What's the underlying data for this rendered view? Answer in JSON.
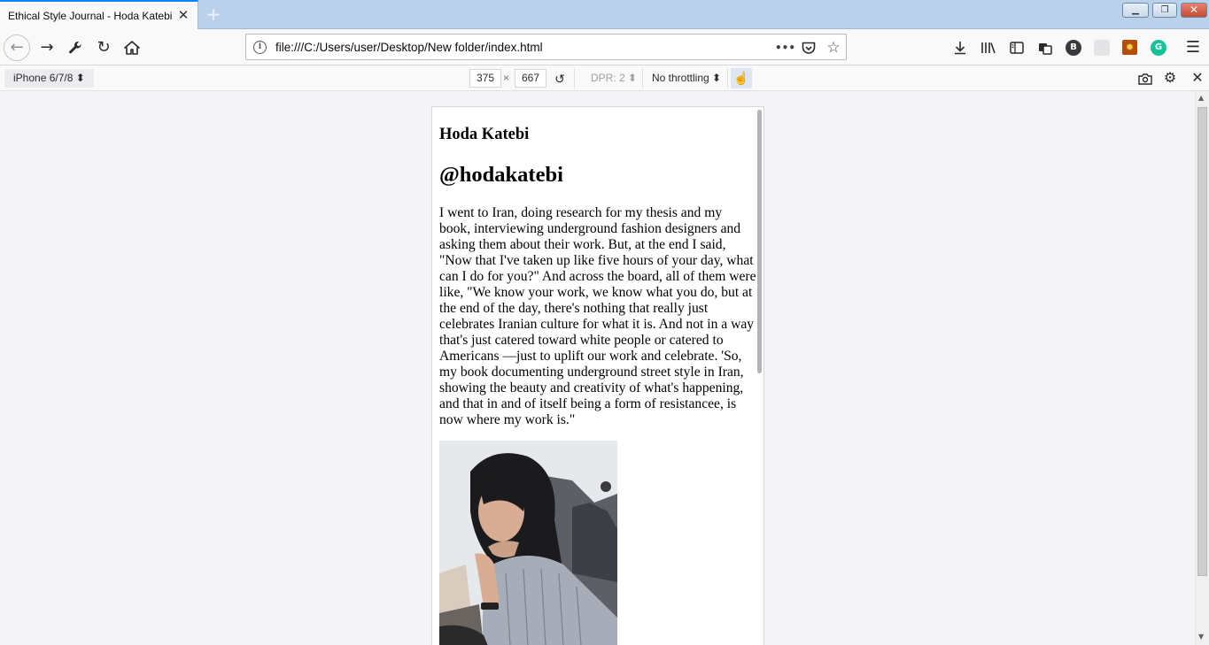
{
  "browser": {
    "tab_title": "Ethical Style Journal - Hoda Katebi",
    "tab_close": "✕",
    "new_tab": "+",
    "window_controls": {
      "minimize": "▁",
      "restore": "❐",
      "close": "✕"
    },
    "url": "file:///C:/Users/user/Desktop/New folder/index.html",
    "page_actions": "•••",
    "toolbar_icons": [
      "download-icon",
      "library-icon",
      "sidebar-icon",
      "extensions-icon",
      "b-plus-icon",
      "addon-icon",
      "addon-icon-2",
      "grammarly-icon",
      "menu-icon"
    ]
  },
  "rdm": {
    "device": "iPhone 6/7/8 ⬍",
    "width": "375",
    "times": "×",
    "height": "667",
    "dpr": "DPR: 2 ⬍",
    "throttling": "No throttling ⬍"
  },
  "page": {
    "name_heading": "Hoda Katebi",
    "handle_heading": "@hodakatebi",
    "quote": "I went to Iran, doing research for my thesis and my book, interviewing underground fashion designers and asking them about their work. But, at the end I said, \"Now that I've taken up like five hours of your day, what can I do for you?\" And across the board, all of them were like, \"We know your work, we know what you do, but at the end of the day, there's nothing that really just celebrates Iranian culture for what it is. And not in a way that's just catered toward white people or catered to Americans —just to uplift our work and celebrate. 'So, my book documenting underground street style in Iran, showing the beauty and creativity of what's happening, and that in and of itself being a form of resistancee, is now where my work is.\""
  },
  "colors": {
    "titlebar": "#b9d1ea",
    "accent": "#0a84ff",
    "toolbar": "#f9f9fa",
    "page_bg": "#f4f4f6"
  }
}
